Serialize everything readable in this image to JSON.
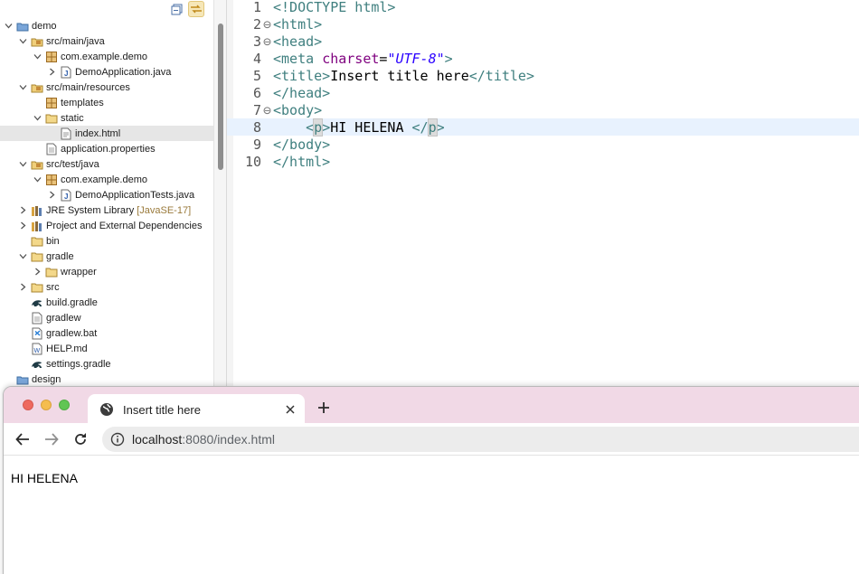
{
  "explorer": {
    "items": [
      {
        "label": "demo",
        "icon": "project-icon",
        "expanded": true
      },
      {
        "label": "src/main/java",
        "icon": "source-folder-icon",
        "expanded": true
      },
      {
        "label": "com.example.demo",
        "icon": "package-icon",
        "expanded": true
      },
      {
        "label": "DemoApplication.java",
        "icon": "java-file-icon",
        "expanded": false
      },
      {
        "label": "src/main/resources",
        "icon": "source-folder-icon",
        "expanded": true
      },
      {
        "label": "templates",
        "icon": "package-icon"
      },
      {
        "label": "static",
        "icon": "folder-icon",
        "expanded": true
      },
      {
        "label": "index.html",
        "icon": "html-file-icon",
        "selected": true
      },
      {
        "label": "application.properties",
        "icon": "file-icon"
      },
      {
        "label": "src/test/java",
        "icon": "source-folder-icon",
        "expanded": true
      },
      {
        "label": "com.example.demo",
        "icon": "package-icon",
        "expanded": true
      },
      {
        "label": "DemoApplicationTests.java",
        "icon": "java-file-icon",
        "expanded": false
      },
      {
        "label": "JRE System Library",
        "decoration": "[JavaSE-17]",
        "icon": "library-icon",
        "expanded": false
      },
      {
        "label": "Project and External Dependencies",
        "icon": "library-icon",
        "expanded": false
      },
      {
        "label": "bin",
        "icon": "folder-icon"
      },
      {
        "label": "gradle",
        "icon": "folder-icon",
        "expanded": true
      },
      {
        "label": "wrapper",
        "icon": "folder-icon",
        "expanded": false
      },
      {
        "label": "src",
        "icon": "folder-icon",
        "expanded": false
      },
      {
        "label": "build.gradle",
        "icon": "gradle-icon"
      },
      {
        "label": "gradlew",
        "icon": "file-icon"
      },
      {
        "label": "gradlew.bat",
        "icon": "vscode-file-icon"
      },
      {
        "label": "HELP.md",
        "icon": "markdown-file-icon"
      },
      {
        "label": "settings.gradle",
        "icon": "gradle-icon"
      },
      {
        "label": "design",
        "icon": "project-icon"
      }
    ]
  },
  "editor": {
    "lines": [
      {
        "num": "1",
        "fold": ""
      },
      {
        "num": "2",
        "fold": "⊖"
      },
      {
        "num": "3",
        "fold": "⊖"
      },
      {
        "num": "4",
        "fold": ""
      },
      {
        "num": "5",
        "fold": ""
      },
      {
        "num": "6",
        "fold": ""
      },
      {
        "num": "7",
        "fold": "⊖"
      },
      {
        "num": "8",
        "fold": ""
      },
      {
        "num": "9",
        "fold": ""
      },
      {
        "num": "10",
        "fold": ""
      }
    ],
    "code": {
      "doctype": "<!DOCTYPE html>",
      "html_open": "<html>",
      "head_open": "<head>",
      "meta_open": "<meta",
      "meta_attr": "charset",
      "meta_eq": "=",
      "meta_val": "\"UTF-8\"",
      "meta_close": ">",
      "title_open": "<title>",
      "title_text": "Insert title here",
      "title_close": "</title>",
      "head_close": "</head>",
      "body_open": "<body>",
      "p_indent": "    ",
      "p_lt": "<",
      "p_name": "p",
      "p_gt": ">",
      "p_text": "HI HELENA ",
      "p_close_lt": "</",
      "p_close_name": "p",
      "p_close_gt": ">",
      "body_close": "</body>",
      "html_close": "</html>"
    }
  },
  "browser": {
    "tab_title": "Insert title here",
    "new_tab_label": "+",
    "url_host": "localhost",
    "url_path": ":8080/index.html",
    "page_text": "HI HELENA"
  },
  "colors": {
    "tag": "#3f7f7f",
    "attribute": "#7f007f",
    "value": "#2a00ff",
    "current_line": "#e8f2fe",
    "tab_strip": "#f1d9e6"
  }
}
